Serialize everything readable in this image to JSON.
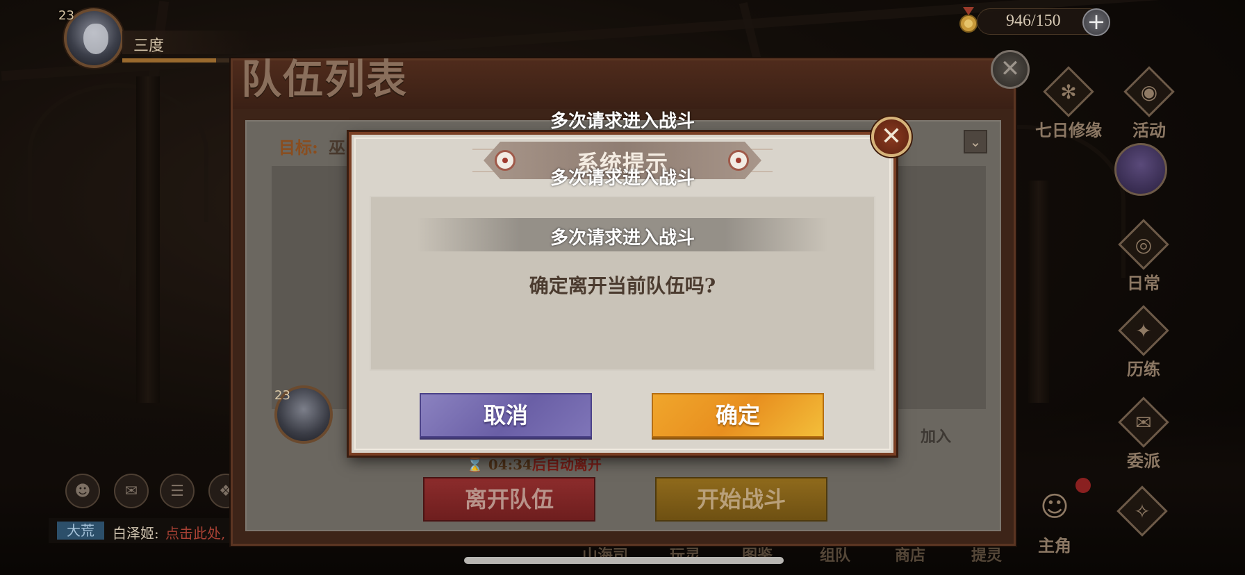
{
  "player": {
    "level": "23",
    "name": "三度",
    "xp_fraction": 0.75
  },
  "stamina": {
    "value": "946/150",
    "plus_icon": "plus-icon"
  },
  "side_menu": [
    {
      "label": "七日修缘",
      "icon": "seven-day-icon",
      "glyph": "✻"
    },
    {
      "label": "活动",
      "icon": "event-icon",
      "glyph": "◉"
    },
    {
      "label": "日常",
      "icon": "daily-icon",
      "glyph": "◎"
    },
    {
      "label": "历练",
      "icon": "training-icon",
      "glyph": "✦"
    },
    {
      "label": "委派",
      "icon": "dispatch-icon",
      "glyph": "✉"
    },
    {
      "label": "主角",
      "icon": "hero-icon",
      "glyph": "☺"
    }
  ],
  "chat": {
    "channel": "大荒",
    "sender": "白泽姬:",
    "message": "点击此处,"
  },
  "bottom_nav": [
    "山海司",
    "玩灵",
    "图鉴",
    "组队",
    "商店",
    "提灵"
  ],
  "team_panel": {
    "title": "队伍列表",
    "target_label": "目标:",
    "target_value": "巫",
    "member_level": "23",
    "join_text": "加入",
    "timer_value": "04:34",
    "timer_suffix": "后自动离开",
    "leave_button": "离开队伍",
    "start_button": "开始战斗"
  },
  "dialog": {
    "title": "系统提示",
    "message": "确定离开当前队伍吗?",
    "cancel_label": "取消",
    "confirm_label": "确定"
  },
  "toasts": [
    "多次请求进入战斗",
    "多次请求进入战斗",
    "多次请求进入战斗"
  ],
  "colors": {
    "cancel_button": "#6a5fa6",
    "confirm_button": "#e88f1f",
    "dialog_frame": "#7a3f24",
    "dialog_bg": "#d9d4cb"
  }
}
